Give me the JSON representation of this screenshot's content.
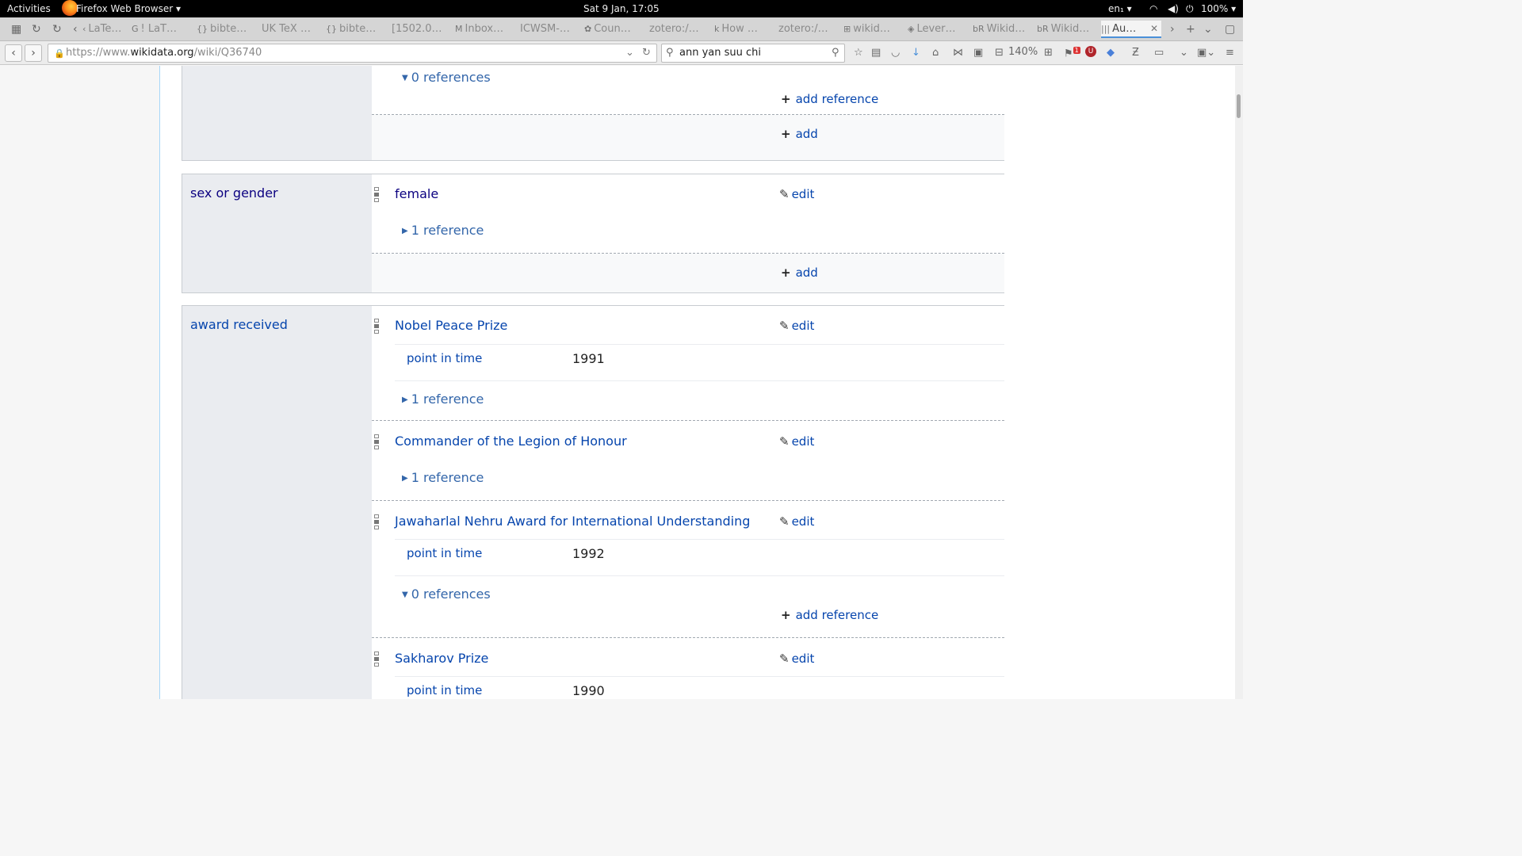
{
  "topbar": {
    "activities": "Activities",
    "app_menu": "Firefox Web Browser",
    "clock": "Sat  9 Jan, 17:05",
    "keyboard": "en₁",
    "battery": "100%"
  },
  "tabs": [
    {
      "label": "LaTe…",
      "icon": "‹"
    },
    {
      "label": "! LaT…",
      "icon": "G"
    },
    {
      "label": "bibte…",
      "icon": "{}"
    },
    {
      "label": "UK TeX …",
      "icon": ""
    },
    {
      "label": "bibte…",
      "icon": "{}"
    },
    {
      "label": "[1502.0…",
      "icon": ""
    },
    {
      "label": "Inbox…",
      "icon": "M"
    },
    {
      "label": "ICWSM-…",
      "icon": ""
    },
    {
      "label": "Coun…",
      "icon": "✿"
    },
    {
      "label": "zotero:/…",
      "icon": ""
    },
    {
      "label": "How …",
      "icon": "k"
    },
    {
      "label": "zotero:/…",
      "icon": ""
    },
    {
      "label": "wikid…",
      "icon": "⊞"
    },
    {
      "label": "Lever…",
      "icon": "◈"
    },
    {
      "label": "Wikid…",
      "icon": "bR"
    },
    {
      "label": "Wikid…",
      "icon": "bR"
    },
    {
      "label": "Au…",
      "icon": "|||"
    }
  ],
  "navbar": {
    "url_prefix": "https://www.",
    "url_domain": "wikidata.org",
    "url_path": "/wiki/Q36740",
    "search_value": "ann yan suu chi",
    "zoom": "140%",
    "notification_count": "1",
    "ublock_letter": "U"
  },
  "groups": {
    "top": {
      "references": "0 references",
      "add_reference": "add reference",
      "add": "add"
    },
    "sex": {
      "property": "sex or gender",
      "value": "female",
      "edit": "edit",
      "references": "1 reference",
      "add": "add"
    },
    "award": {
      "property": "award received",
      "statements": [
        {
          "value": "Nobel Peace Prize",
          "edit": "edit",
          "qualifier": "point in time",
          "qualifier_value": "1991",
          "references": "1 reference"
        },
        {
          "value": "Commander of the Legion of Honour",
          "edit": "edit",
          "references": "1 reference"
        },
        {
          "value": "Jawaharlal Nehru Award for International Understanding",
          "edit": "edit",
          "qualifier": "point in time",
          "qualifier_value": "1992",
          "references": "0 references",
          "add_reference": "add reference"
        },
        {
          "value": "Sakharov Prize",
          "edit": "edit",
          "qualifier": "point in time",
          "qualifier_value": "1990"
        }
      ]
    }
  },
  "colors": {
    "link": "#0645ad",
    "visited_link": "#0b0080",
    "reference_link": "#3366aa",
    "label_cell_bg": "#eaecf0",
    "group_border": "#c8ccd1"
  }
}
